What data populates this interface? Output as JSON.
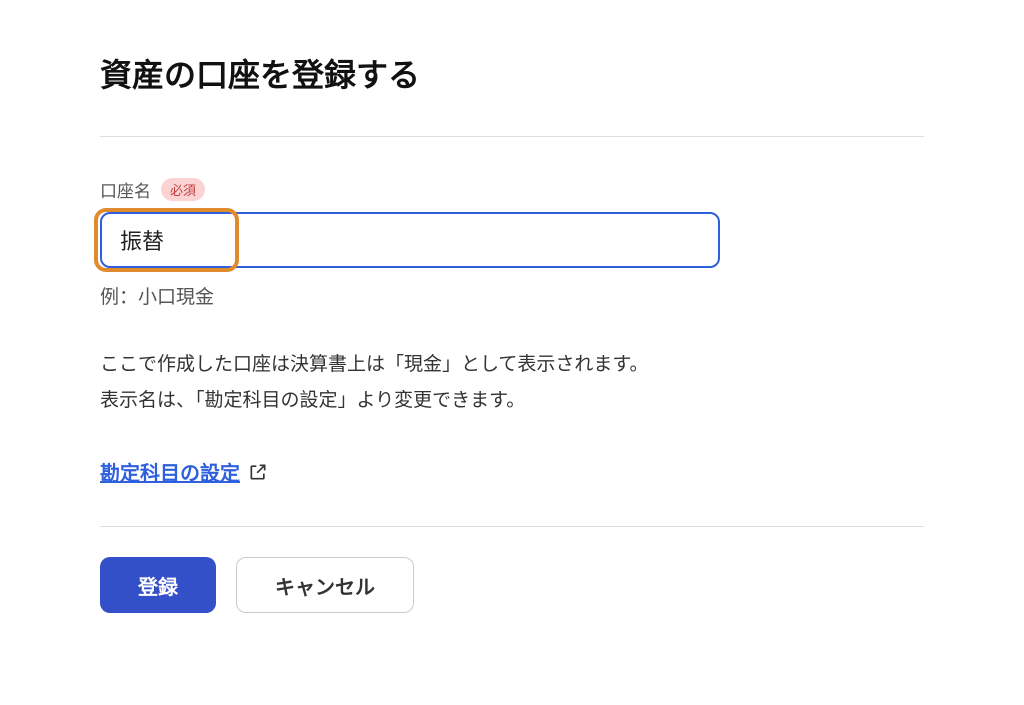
{
  "page": {
    "title": "資産の口座を登録する"
  },
  "form": {
    "account_name": {
      "label": "口座名",
      "required_badge": "必須",
      "value": "振替",
      "example": "例：小口現金"
    },
    "description_line1": "ここで作成した口座は決算書上は「現金」として表示されます。",
    "description_line2": "表示名は、「勘定科目の設定」より変更できます。"
  },
  "link": {
    "settings_label": "勘定科目の設定"
  },
  "buttons": {
    "submit": "登録",
    "cancel": "キャンセル"
  }
}
